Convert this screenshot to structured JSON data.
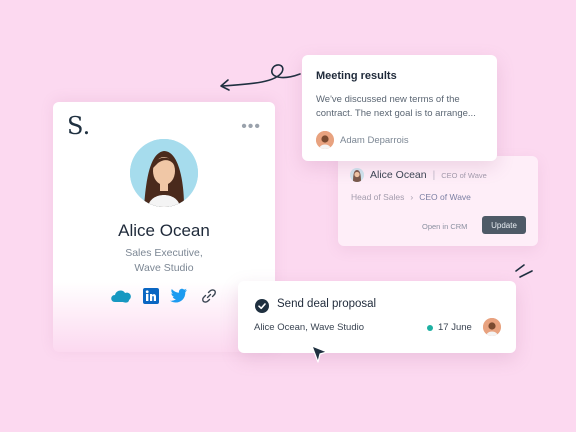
{
  "profile": {
    "logo": "S.",
    "more_icon": "more-dots-icon",
    "name": "Alice Ocean",
    "role_line1": "Sales Executive,",
    "role_line2": "Wave Studio",
    "socials": [
      "salesforce-icon",
      "linkedin-icon",
      "twitter-icon",
      "link-icon"
    ]
  },
  "meeting": {
    "title": "Meeting results",
    "text": "We've discussed new terms of the contract. The next goal is to arrange...",
    "author": "Adam Deparrois"
  },
  "crm": {
    "name": "Alice Ocean",
    "separator": "|",
    "subtitle": "CEO of Wave",
    "path_from": "Head of Sales",
    "path_arrow": "›",
    "path_to": "CEO of Wave",
    "open_label": "Open in CRM",
    "update_label": "Update"
  },
  "task": {
    "title": "Send deal proposal",
    "company": "Alice Ocean, Wave Studio",
    "date": "17 June"
  },
  "colors": {
    "background": "#fcd9f0",
    "accent_dark": "#1f3040",
    "button": "#4e5a67",
    "status_teal": "#1db0a2",
    "salesforce": "#1798c1",
    "linkedin": "#0a66c2",
    "twitter": "#1d9bf0"
  }
}
